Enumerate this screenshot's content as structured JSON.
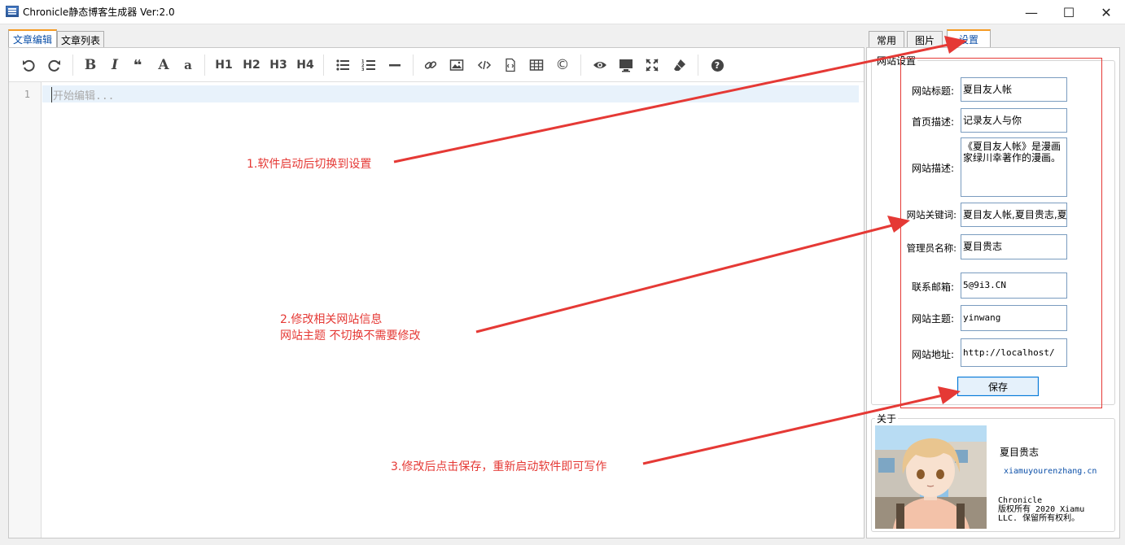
{
  "window": {
    "title": "Chronicle静态博客生成器 Ver:2.0",
    "min_label": "—",
    "max_label": "☐",
    "close_label": "✕"
  },
  "left_tabs": [
    {
      "label": "文章编辑",
      "active": true
    },
    {
      "label": "文章列表",
      "active": false
    }
  ],
  "toolbar": {
    "icons": [
      "undo-icon",
      "redo-icon",
      "bold-icon",
      "italic-icon",
      "quote-icon",
      "heading-icon",
      "heading-smaller-icon",
      "h1-icon",
      "h2-icon",
      "h3-icon",
      "h4-icon",
      "unordered-list-icon",
      "ordered-list-icon",
      "horizontal-rule-icon",
      "link-icon",
      "image-icon",
      "code-icon",
      "code-file-icon",
      "table-icon",
      "copyright-icon",
      "preview-icon",
      "side-by-side-icon",
      "fullscreen-icon",
      "eraser-icon",
      "help-icon"
    ],
    "bold": "B",
    "italic": "I",
    "quote": "❝",
    "heading": "A",
    "heading_small": "a",
    "h1": "H1",
    "h2": "H2",
    "h3": "H3",
    "h4": "H4",
    "copyright": "©",
    "help": "?"
  },
  "editor": {
    "line_number": "1",
    "placeholder": "开始编辑..."
  },
  "right_tabs": [
    {
      "label": "常用",
      "active": false
    },
    {
      "label": "图片",
      "active": false
    },
    {
      "label": "设置",
      "active": true
    }
  ],
  "settings": {
    "group_title": "网站设置",
    "fields": [
      {
        "label": "网站标题:",
        "value": "夏目友人帐"
      },
      {
        "label": "首页描述:",
        "value": "记录友人与你"
      },
      {
        "label": "网站描述:",
        "value": "《夏目友人帐》是漫画家绿川幸著作的漫画。"
      },
      {
        "label": "网站关键词:",
        "value": "夏目友人帐,夏目贵志,夏"
      },
      {
        "label": "管理员名称:",
        "value": "夏目贵志"
      },
      {
        "label": "联系邮箱:",
        "value": "5@9i3.CN"
      },
      {
        "label": "网站主题:",
        "value": "yinwang"
      },
      {
        "label": "网站地址:",
        "value": "http://localhost/"
      }
    ],
    "save_label": "保存"
  },
  "about": {
    "group_title": "关于",
    "name": "夏目贵志",
    "url": "xiamuyourenzhang.cn",
    "line1": "Chronicle",
    "line2": "版权所有 2020 Xiamu",
    "line3": "LLC. 保留所有权利。"
  },
  "annotations": {
    "step1": "1.软件启动后切换到设置",
    "step2_line1": "2.修改相关网站信息",
    "step2_line2": "网站主题 不切换不需要修改",
    "step3": "3.修改后点击保存，重新启动软件即可写作"
  },
  "colors": {
    "annotation_red": "#e53935",
    "tab_accent": "#f59a23",
    "link_blue": "#0b4fa8"
  }
}
